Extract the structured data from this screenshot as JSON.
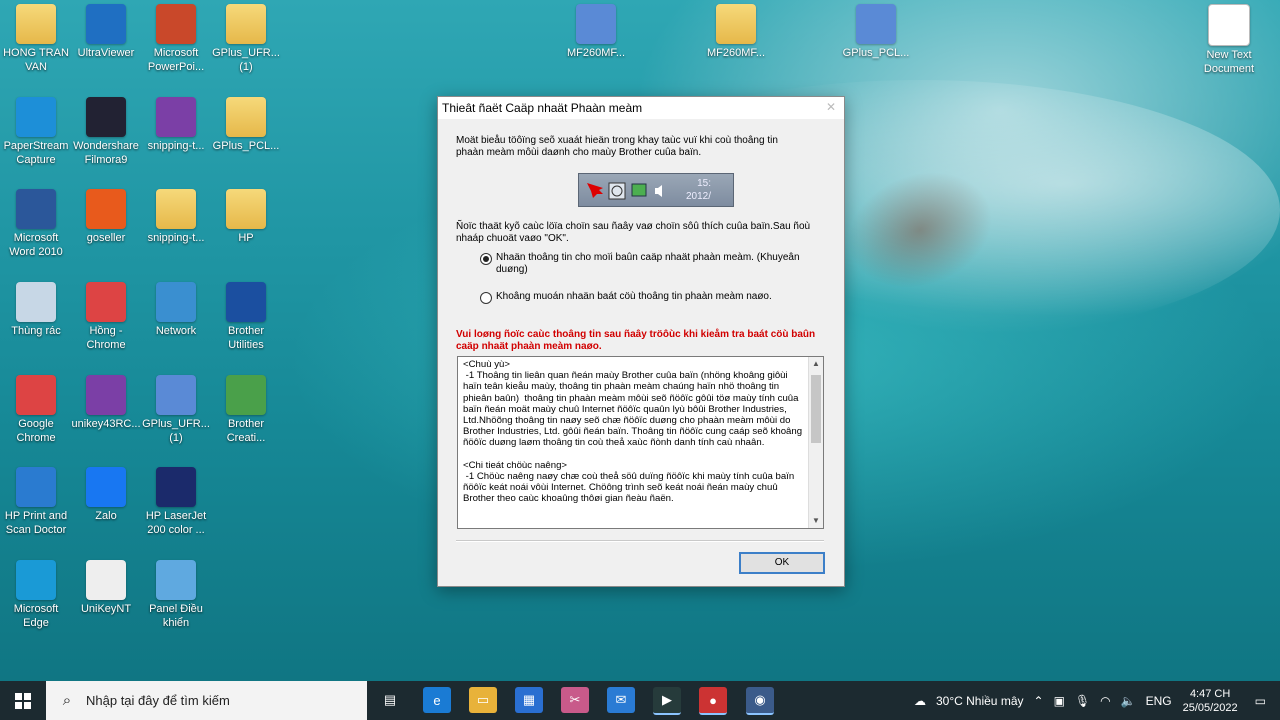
{
  "desktop": {
    "icons": [
      {
        "label": "HONG TRAN VAN",
        "icon": "user-folder-icon"
      },
      {
        "label": "UltraViewer",
        "icon": "monitor-icon"
      },
      {
        "label": "Microsoft PowerPoi...",
        "icon": "powerpoint-icon"
      },
      {
        "label": "GPlus_UFR... (1)",
        "icon": "folder-icon"
      },
      {
        "label": "PaperStream Capture",
        "icon": "paperstream-icon"
      },
      {
        "label": "Wondershare Filmora9",
        "icon": "filmora-icon"
      },
      {
        "label": "snipping-t...",
        "icon": "winrar-icon"
      },
      {
        "label": "GPlus_PCL...",
        "icon": "folder-icon"
      },
      {
        "label": "Microsoft Word 2010",
        "icon": "word-icon"
      },
      {
        "label": "goseller",
        "icon": "goseller-icon"
      },
      {
        "label": "snipping-t...",
        "icon": "folder-icon"
      },
      {
        "label": "HP",
        "icon": "folder-icon"
      },
      {
        "label": "Thùng rác",
        "icon": "recycle-bin-icon"
      },
      {
        "label": "Hồng - Chrome",
        "icon": "chrome-icon"
      },
      {
        "label": "Network",
        "icon": "network-icon"
      },
      {
        "label": "Brother Utilities",
        "icon": "brother-utilities-icon"
      },
      {
        "label": "Google Chrome",
        "icon": "chrome-icon"
      },
      {
        "label": "unikey43RC...",
        "icon": "winrar-icon"
      },
      {
        "label": "GPlus_UFR... (1)",
        "icon": "installer-icon"
      },
      {
        "label": "Brother Creati...",
        "icon": "brother-creative-icon"
      },
      {
        "label": "HP Print and Scan Doctor",
        "icon": "hp-doctor-icon"
      },
      {
        "label": "Zalo",
        "icon": "zalo-icon"
      },
      {
        "label": "HP LaserJet 200 color ...",
        "icon": "hp-help-icon"
      },
      {
        "label": "Microsoft Edge",
        "icon": "edge-icon"
      },
      {
        "label": "UniKeyNT",
        "icon": "unikey-icon"
      },
      {
        "label": "Panel Điều khiển",
        "icon": "control-panel-icon"
      },
      {
        "label": "MF260MF...",
        "icon": "installer-icon"
      },
      {
        "label": "MF260MF...",
        "icon": "folder-icon"
      },
      {
        "label": "GPlus_PCL...",
        "icon": "installer-icon"
      },
      {
        "label": "New Text Document",
        "icon": "text-document-icon"
      }
    ]
  },
  "dialog": {
    "title": "Thieât ñaët Caäp nhaät Phaàn meàm",
    "close": "✕",
    "intro": "Moät bieåu töôïng seõ xuaát hieän trong khay taùc vuï khi coù thoâng tin phaàn meàm môùi daønh cho maùy Brother cuûa baïn.",
    "tray_time": "15:",
    "tray_date": "2012/",
    "instruction": "Ñoïc thaät kyõ caùc löïa choïn sau ñaây vaø choïn sôû thích cuûa baïn.Sau ñoù nhaáp chuoät vaøo \"OK\".",
    "option1": "Nhaän thoâng tin cho moïi baûn caäp nhaät phaàn meàm. (Khuyeân duøng)",
    "option2": "Khoâng muoán nhaän baát cöù thoâng tin phaàn meàm naøo.",
    "warning": "Vui loøng ñoïc caùc thoâng tin sau ñaây tröôùc khi kieåm tra baát cöù baûn caäp nhaät phaàn meàm naøo.",
    "terms": "<Chuù yù>\n -1 Thoâng tin lieân quan ñeán maùy Brother cuûa baïn (nhöng khoâng giôùi haïn teân kieåu maùy, thoâng tin phaàn meàm chaúng haïn nhö thoâng tin phieân baûn)  thoâng tin phaàn meàm môùi seõ ñöôïc gôûi töø maùy tính cuûa baïn ñeán moät maùy chuû Internet ñöôïc quaûn lyù bôûi Brother Industries, Ltd.Nhöõng thoâng tin naøy seõ chæ ñöôïc duøng cho phaàn meàm môùi do Brother Industries, Ltd. gôûi ñeán baïn. Thoâng tin ñöôïc cung caáp seõ khoâng ñöôïc duøng laøm thoâng tin coù theå xaùc ñònh danh tính caù nhaân.\n\n<Chi tieát chöùc naêng>\n -1 Chöùc naêng naøy chæ coù theå söû duïng ñöôïc khi maùy tính cuûa baïn ñöôïc keát noái vôùi Internet. Chöông trình seõ keát noái ñeán maùy chuû Brother theo caùc khoaûng thôøi gian ñeàu ñaën.",
    "ok": "OK"
  },
  "taskbar": {
    "search_placeholder": "Nhập tại đây để tìm kiếm",
    "weather": "30°C  Nhiều mây",
    "lang": "ENG",
    "time": "4:47 CH",
    "date": "25/05/2022"
  }
}
